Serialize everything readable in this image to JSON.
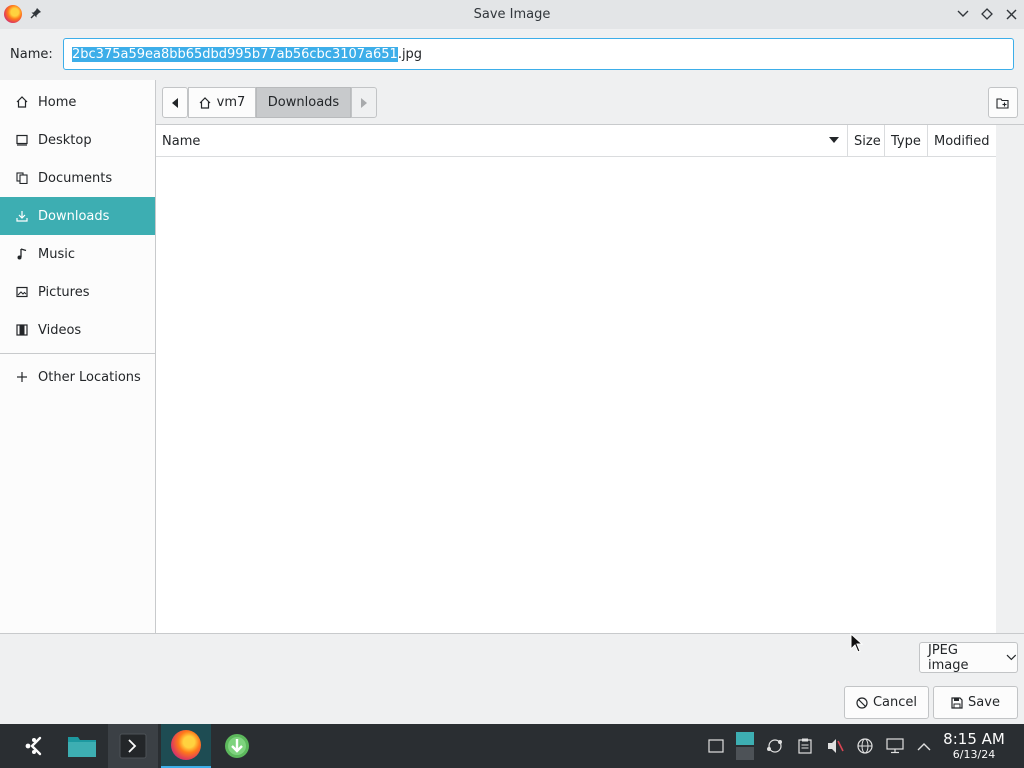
{
  "window": {
    "title": "Save Image"
  },
  "name_row": {
    "label": "Name:",
    "filename_selected": "2bc375a59ea8bb65dbd995b77ab56cbc3107a651",
    "filename_ext": ".jpg"
  },
  "sidebar": {
    "items": [
      {
        "label": "Home",
        "icon": "home-icon"
      },
      {
        "label": "Desktop",
        "icon": "desktop-icon"
      },
      {
        "label": "Documents",
        "icon": "documents-icon"
      },
      {
        "label": "Downloads",
        "icon": "download-icon",
        "active": true
      },
      {
        "label": "Music",
        "icon": "music-icon"
      },
      {
        "label": "Pictures",
        "icon": "pictures-icon"
      },
      {
        "label": "Videos",
        "icon": "videos-icon"
      }
    ],
    "other": {
      "label": "Other Locations",
      "icon": "plus-icon"
    }
  },
  "pathbar": {
    "home": "vm7",
    "current": "Downloads"
  },
  "columns": {
    "name": "Name",
    "size": "Size",
    "type": "Type",
    "modified": "Modified"
  },
  "filter": {
    "selected": "JPEG image"
  },
  "buttons": {
    "cancel": "Cancel",
    "save": "Save"
  },
  "clock": {
    "time": "8:15 AM",
    "date": "6/13/24"
  },
  "colors": {
    "accent": "#3daee9",
    "sidebar_active": "#3daeb2",
    "taskbar": "#2a2e32"
  }
}
